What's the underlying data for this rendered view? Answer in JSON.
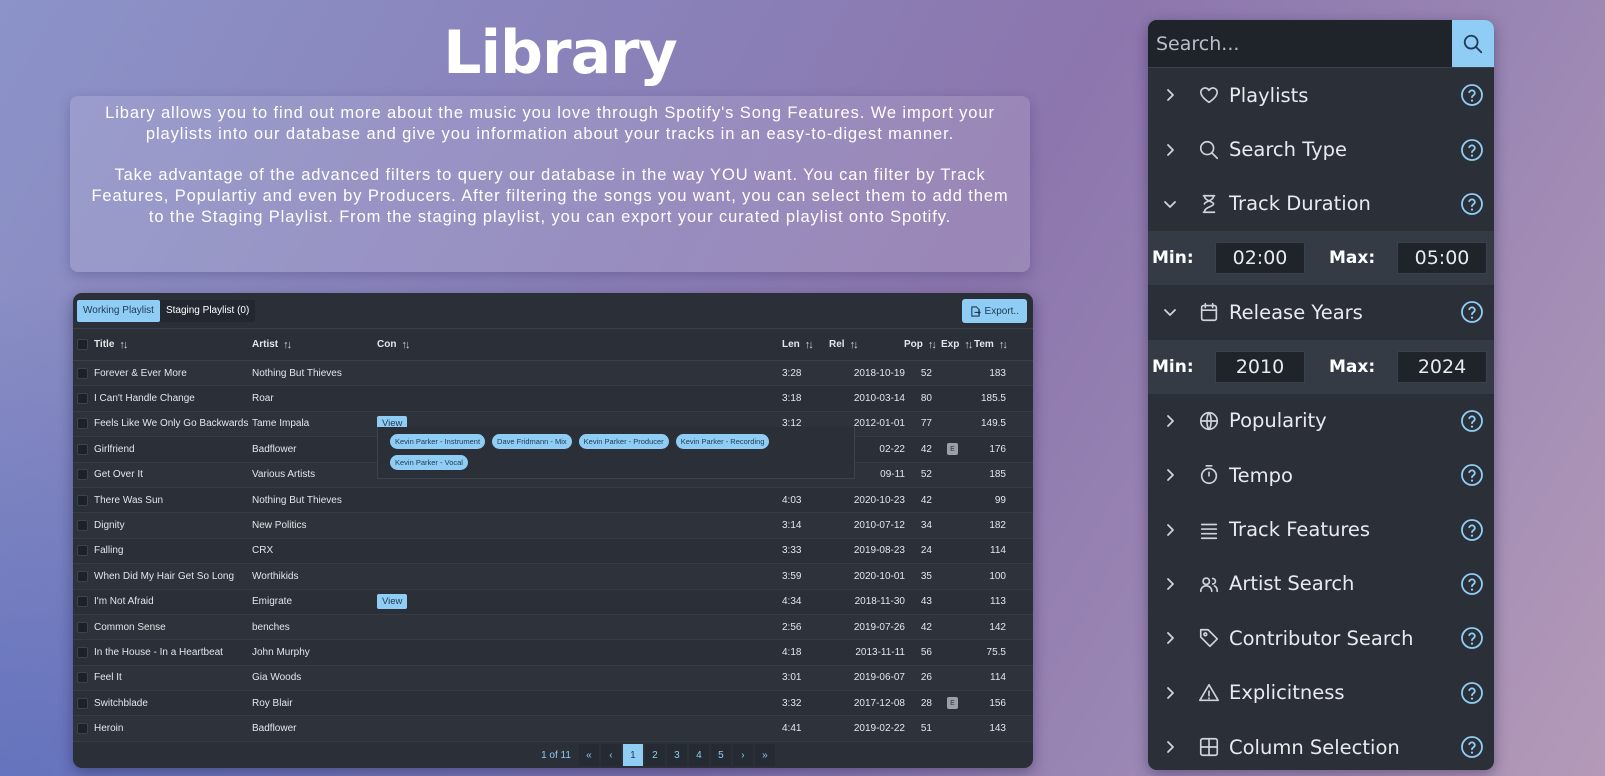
{
  "page": {
    "title": "Library",
    "intro_p1": "Libary allows you to find out more about the music you love through Spotify's Song Features. We import your playlists into our database and give you information about your tracks in an easy-to-digest manner.",
    "intro_p2": "Take advantage of the advanced filters to query our database in the way YOU want. You can filter by Track Features, Populartiy and even by Producers. After filtering the songs you want, you can select them to add them to the Staging Playlist. From the staging playlist, you can export your curated playlist onto Spotify."
  },
  "table": {
    "tabs": [
      "Working Playlist",
      "Staging Playlist (0)"
    ],
    "export_label": "Export..",
    "columns": {
      "title": "Title",
      "artist": "Artist",
      "con": "Con",
      "len": "Len",
      "rel": "Rel",
      "pop": "Pop",
      "exp": "Exp",
      "tem": "Tem"
    },
    "view_label": "View",
    "explicit_badge": "E",
    "rows": [
      {
        "title": "Forever & Ever More",
        "artist": "Nothing But Thieves",
        "len": "3:28",
        "rel": "2018-10-19",
        "pop": "52",
        "tem": "183",
        "view": false,
        "exp": false
      },
      {
        "title": "I Can't Handle Change",
        "artist": "Roar",
        "len": "3:18",
        "rel": "2010-03-14",
        "pop": "80",
        "tem": "185.5",
        "view": false,
        "exp": false
      },
      {
        "title": "Feels Like We Only Go Backwards",
        "artist": "Tame Impala",
        "len": "3:12",
        "rel": "2012-01-01",
        "pop": "77",
        "tem": "149.5",
        "view": true,
        "exp": false
      },
      {
        "title": "Girlfriend",
        "artist": "Badflower",
        "len": "",
        "rel": "02-22",
        "pop": "42",
        "tem": "176",
        "view": false,
        "exp": true
      },
      {
        "title": "Get Over It",
        "artist": "Various Artists",
        "len": "",
        "rel": "09-11",
        "pop": "52",
        "tem": "185",
        "view": false,
        "exp": false
      },
      {
        "title": "There Was Sun",
        "artist": "Nothing But Thieves",
        "len": "4:03",
        "rel": "2020-10-23",
        "pop": "42",
        "tem": "99",
        "view": false,
        "exp": false
      },
      {
        "title": "Dignity",
        "artist": "New Politics",
        "len": "3:14",
        "rel": "2010-07-12",
        "pop": "34",
        "tem": "182",
        "view": false,
        "exp": false
      },
      {
        "title": "Falling",
        "artist": "CRX",
        "len": "3:33",
        "rel": "2019-08-23",
        "pop": "24",
        "tem": "114",
        "view": false,
        "exp": false
      },
      {
        "title": "When Did My Hair Get So Long",
        "artist": "Worthikids",
        "len": "3:59",
        "rel": "2020-10-01",
        "pop": "35",
        "tem": "100",
        "view": false,
        "exp": false
      },
      {
        "title": "I'm Not Afraid",
        "artist": "Emigrate",
        "len": "4:34",
        "rel": "2018-11-30",
        "pop": "43",
        "tem": "113",
        "view": true,
        "exp": false
      },
      {
        "title": "Common Sense",
        "artist": "benches",
        "len": "2:56",
        "rel": "2019-07-26",
        "pop": "42",
        "tem": "142",
        "view": false,
        "exp": false
      },
      {
        "title": "In the House - In a Heartbeat",
        "artist": "John Murphy",
        "len": "4:18",
        "rel": "2013-11-11",
        "pop": "56",
        "tem": "75.5",
        "view": false,
        "exp": false
      },
      {
        "title": "Feel It",
        "artist": "Gia Woods",
        "len": "3:01",
        "rel": "2019-06-07",
        "pop": "26",
        "tem": "114",
        "view": false,
        "exp": false
      },
      {
        "title": "Switchblade",
        "artist": "Roy Blair",
        "len": "3:32",
        "rel": "2017-12-08",
        "pop": "28",
        "tem": "156",
        "view": false,
        "exp": true
      },
      {
        "title": "Heroin",
        "artist": "Badflower",
        "len": "4:41",
        "rel": "2019-02-22",
        "pop": "51",
        "tem": "143",
        "view": false,
        "exp": false
      }
    ],
    "contributors": [
      "Kevin Parker - Instrument",
      "Dave Fridmann - Mix",
      "Kevin Parker - Producer",
      "Kevin Parker - Recording",
      "Kevin Parker - Vocal"
    ],
    "pagination": {
      "info": "1 of 11",
      "first": "«",
      "prev": "‹",
      "pages": [
        "1",
        "2",
        "3",
        "4",
        "5"
      ],
      "current": "1",
      "next": "›",
      "last": "»"
    }
  },
  "filters": {
    "search_placeholder": "Search...",
    "sections": [
      {
        "label": "Playlists",
        "icon": "heart-icon",
        "expanded": false
      },
      {
        "label": "Search Type",
        "icon": "search-icon",
        "expanded": false
      },
      {
        "label": "Track Duration",
        "icon": "hourglass-icon",
        "expanded": true,
        "min_label": "Min:",
        "min": "02:00",
        "max_label": "Max:",
        "max": "05:00"
      },
      {
        "label": "Release Years",
        "icon": "calendar-icon",
        "expanded": true,
        "min_label": "Min:",
        "min": "2010",
        "max_label": "Max:",
        "max": "2024"
      },
      {
        "label": "Popularity",
        "icon": "globe-icon",
        "expanded": false
      },
      {
        "label": "Tempo",
        "icon": "stopwatch-icon",
        "expanded": false
      },
      {
        "label": "Track Features",
        "icon": "list-icon",
        "expanded": false
      },
      {
        "label": "Artist Search",
        "icon": "users-icon",
        "expanded": false
      },
      {
        "label": "Contributor Search",
        "icon": "tag-icon",
        "expanded": false
      },
      {
        "label": "Explicitness",
        "icon": "warning-icon",
        "expanded": false
      },
      {
        "label": "Column Selection",
        "icon": "grid-icon",
        "expanded": false
      }
    ]
  },
  "colors": {
    "accent": "#90cdf4",
    "panel": "#2a2f38",
    "input": "#1f232a"
  }
}
